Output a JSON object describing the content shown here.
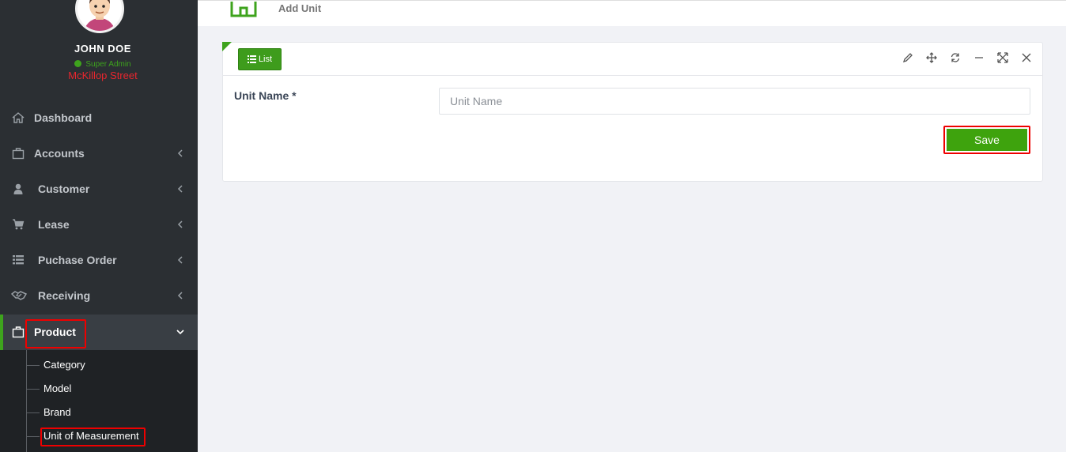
{
  "colors": {
    "accent": "#3ea31d",
    "sidebar_bg": "#2b2f33",
    "highlight": "#ee0000",
    "location": "#e8262e"
  },
  "user": {
    "name": "JOHN DOE",
    "role": "Super Admin",
    "location": "McKillop Street"
  },
  "sidebar": {
    "items": [
      {
        "label": "Dashboard",
        "icon": "home-icon"
      },
      {
        "label": "Accounts",
        "icon": "briefcase-icon"
      },
      {
        "label": "Customer",
        "icon": "user-icon"
      },
      {
        "label": "Lease",
        "icon": "cart-icon"
      },
      {
        "label": "Puchase Order",
        "icon": "list-icon"
      },
      {
        "label": "Receiving",
        "icon": "handshake-icon"
      },
      {
        "label": "Product",
        "icon": "briefcase-icon"
      }
    ],
    "product_submenu": [
      "Category",
      "Model",
      "Brand",
      "Unit of Measurement"
    ]
  },
  "header": {
    "title": "Add Unit",
    "icon": "building-icon"
  },
  "panel": {
    "list_button": "List",
    "tools": [
      "pencil-icon",
      "move-icon",
      "refresh-icon",
      "minimize-icon",
      "expand-icon",
      "close-icon"
    ],
    "form": {
      "label": "Unit Name *",
      "placeholder": "Unit Name",
      "value": ""
    },
    "save_label": "Save"
  }
}
